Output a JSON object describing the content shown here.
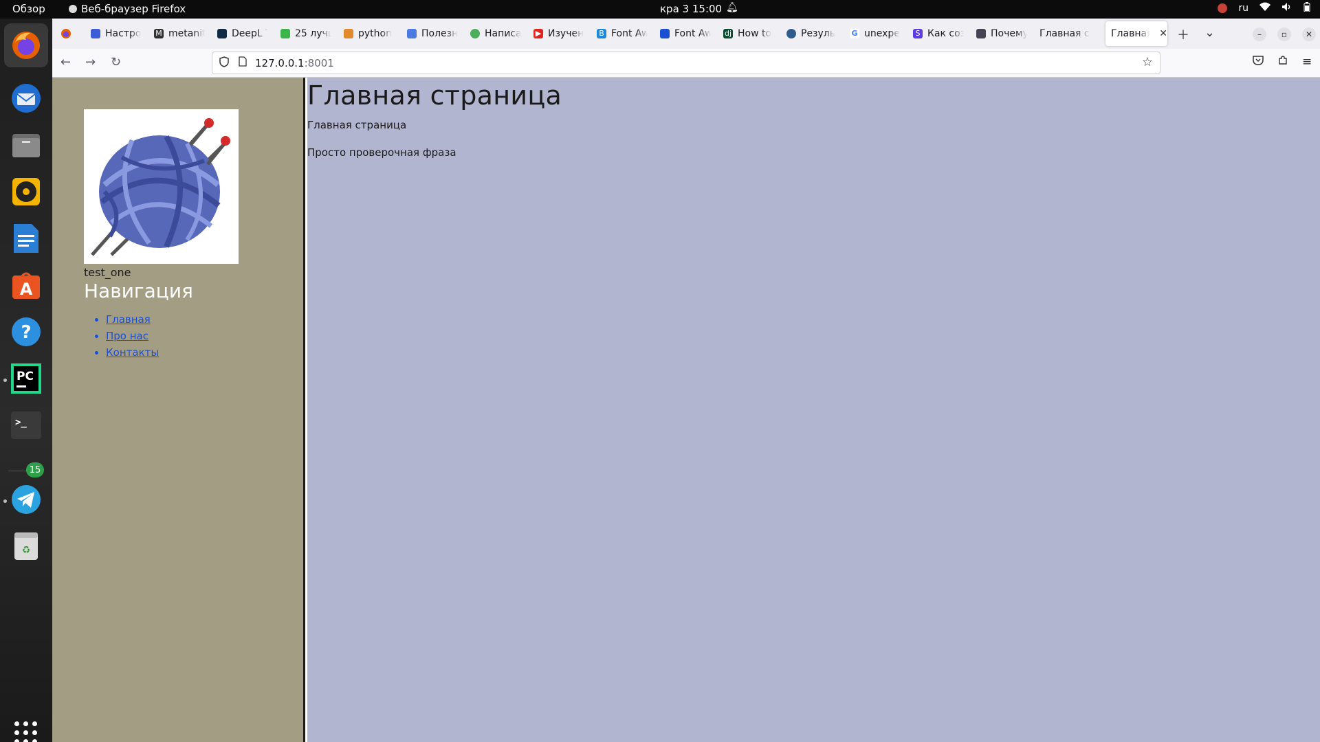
{
  "topbar": {
    "overview": "Обзор",
    "app_name": "Веб-браузер Firefox",
    "clock": "кра 3  15:00",
    "lang": "ru"
  },
  "dock": {
    "badge": "15",
    "items": [
      "firefox-icon",
      "thunderbird-icon",
      "files-icon",
      "rhythmbox-icon",
      "writer-icon",
      "app-center-icon",
      "help-icon",
      "pycharm-icon",
      "terminal-icon",
      "telegram-icon",
      "trash-icon"
    ]
  },
  "tabs": [
    {
      "label": "Настро",
      "color": "#3b5ed7"
    },
    {
      "label": "metanit",
      "color": "#333333"
    },
    {
      "label": "DeepL T",
      "color": "#0f2b46"
    },
    {
      "label": "25 лучш",
      "color": "#3bb54a"
    },
    {
      "label": "python",
      "color": "#e08a2b"
    },
    {
      "label": "Полезн",
      "color": "#4a7be0"
    },
    {
      "label": "Написа",
      "color": "#4cae5a"
    },
    {
      "label": "Изучен",
      "color": "#e0231f"
    },
    {
      "label": "Font Aw",
      "color": "#1e88d8"
    },
    {
      "label": "Font Aw",
      "color": "#1b4fd1"
    },
    {
      "label": "How to",
      "color": "#0c4b33"
    },
    {
      "label": "Резуль",
      "color": "#2f5c8a"
    },
    {
      "label": "unexpe",
      "color": "#4285f4"
    },
    {
      "label": "Как соз",
      "color": "#5b3ce0"
    },
    {
      "label": "Почему",
      "color": "#444455"
    },
    {
      "label": "Главная ст",
      "color": ""
    },
    {
      "label": "Главная",
      "color": ""
    }
  ],
  "address": {
    "host": "127.0.0.1",
    "port": ":8001"
  },
  "page": {
    "username": "test_one",
    "nav_title": "Навигация",
    "nav_links": [
      "Главная",
      "Про нас",
      "Контакты"
    ],
    "heading": "Главная страница",
    "paragraph1": "Главная страница",
    "paragraph2": "Просто проверочная фраза"
  },
  "colors": {
    "sidebar_bg": "#a39d84",
    "main_bg": "#b1b5cf",
    "link": "#1a4fd8"
  }
}
